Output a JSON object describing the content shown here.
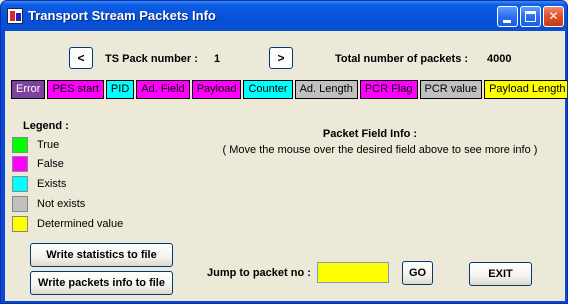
{
  "window": {
    "title": "Transport Stream Packets Info"
  },
  "nav": {
    "prev_label": "<",
    "next_label": ">",
    "ts_pack_label": "TS Pack number :",
    "ts_pack_value": "1",
    "total_label": "Total number of packets :",
    "total_value": "4000"
  },
  "fields": [
    {
      "label": "Error",
      "color": "#8040a0",
      "text_color": "#ffffff"
    },
    {
      "label": "PES start",
      "color": "#ff00ff",
      "text_color": "#000000"
    },
    {
      "label": "PID",
      "color": "#00ffff",
      "text_color": "#000000"
    },
    {
      "label": "Ad. Field",
      "color": "#ff00ff",
      "text_color": "#000000"
    },
    {
      "label": "Payload",
      "color": "#ff00ff",
      "text_color": "#000000"
    },
    {
      "label": "Counter",
      "color": "#00ffff",
      "text_color": "#000000"
    },
    {
      "label": "Ad. Length",
      "color": "#c0c0c0",
      "text_color": "#000000"
    },
    {
      "label": "PCR Flag",
      "color": "#ff00ff",
      "text_color": "#000000"
    },
    {
      "label": "PCR value",
      "color": "#c0c0c0",
      "text_color": "#000000"
    },
    {
      "label": "Payload Length",
      "color": "#ffff00",
      "text_color": "#000000"
    }
  ],
  "legend": {
    "title": "Legend :",
    "items": [
      {
        "label": "True",
        "color": "#00ff00"
      },
      {
        "label": "False",
        "color": "#ff00ff"
      },
      {
        "label": "Exists",
        "color": "#00ffff"
      },
      {
        "label": "Not exists",
        "color": "#c0c0c0"
      },
      {
        "label": "Determined value",
        "color": "#ffff00"
      }
    ]
  },
  "info": {
    "title": "Packet Field Info :",
    "hint": "( Move the mouse over the desired field above to see more info )"
  },
  "buttons": {
    "write_stats": "Write statistics to file",
    "write_packets": "Write packets info to file",
    "jump_label": "Jump to packet no :",
    "jump_value": "",
    "go": "GO",
    "exit": "EXIT"
  }
}
